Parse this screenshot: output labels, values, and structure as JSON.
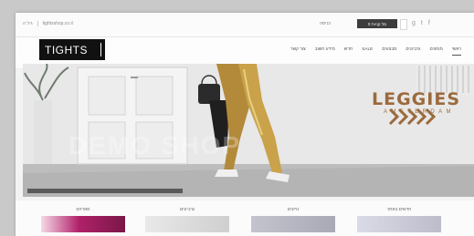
{
  "topbar": {
    "left_items": [
      "גיל ה",
      "tightsshop.co.il"
    ],
    "login": "כניסה",
    "cart_label": "סל קניות 0",
    "social_icons": [
      "google-plus-icon",
      "twitter-icon",
      "facebook-icon"
    ]
  },
  "logo": {
    "text": "TIGHTS"
  },
  "nav": {
    "items": [
      {
        "label": "ראשי",
        "active": true
      },
      {
        "label": "מותגים"
      },
      {
        "label": "גרביונים"
      },
      {
        "label": "מבצעים"
      },
      {
        "label": "SALE"
      },
      {
        "label": "חדש"
      },
      {
        "label": "מידע חשוב"
      },
      {
        "label": "צור קשר"
      }
    ]
  },
  "hero": {
    "brand_title": "LEGGIES",
    "brand_subtitle": "AMSTERDAM",
    "watermark": "DEMO SHOP"
  },
  "categories": [
    {
      "label": "מארזים",
      "color": "#b0216a"
    },
    {
      "label": "גרביונים",
      "color": "#d7d7d7"
    },
    {
      "label": "טייצים",
      "color": "#b7b7c0"
    },
    {
      "label": "חדשים באתר",
      "color": "#c8c8d4"
    }
  ],
  "colors": {
    "brand": "#9b6a3c",
    "dark": "#3d3d3d"
  }
}
